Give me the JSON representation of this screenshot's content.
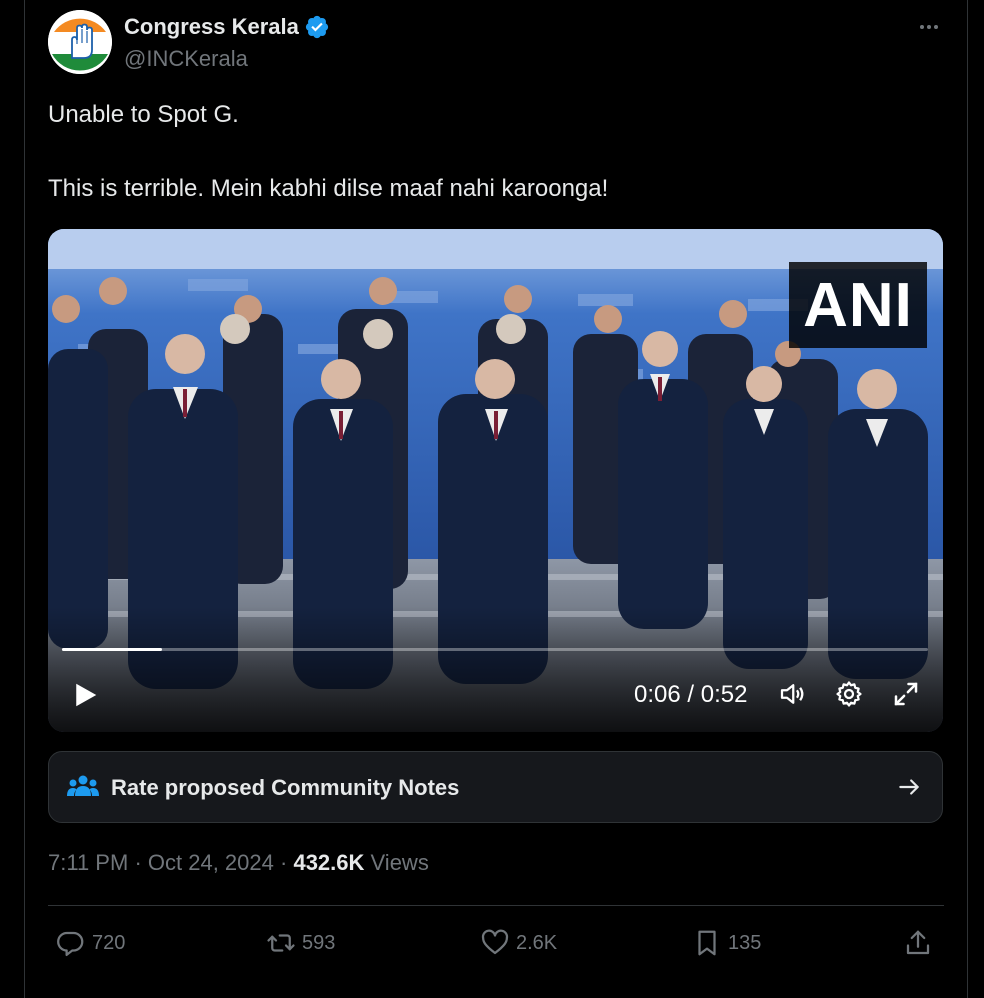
{
  "author": {
    "display_name": "Congress Kerala",
    "handle": "@INCKerala",
    "verified": true,
    "avatar_icon": "congress-hand-logo"
  },
  "tweet": {
    "line1": "Unable to Spot G.",
    "line2": "This is terrible. Mein kabhi dilse maaf nahi karoonga!"
  },
  "video": {
    "watermark": "ANI",
    "current_time": "0:06",
    "duration": "0:52",
    "time_display": "0:06 / 0:52",
    "progress_fraction": 0.115,
    "state": "paused"
  },
  "community_notes": {
    "label": "Rate proposed Community Notes"
  },
  "meta": {
    "time": "7:11 PM",
    "date": "Oct 24, 2024",
    "views_count": "432.6K",
    "views_label": "Views"
  },
  "actions": {
    "replies": "720",
    "reposts": "593",
    "likes": "2.6K",
    "bookmarks": "135"
  },
  "colors": {
    "background": "#000000",
    "text": "#e7e9ea",
    "muted": "#71767b",
    "border": "#2f3336",
    "verified": "#1d9bf0",
    "notes_icon": "#1d9bf0"
  }
}
